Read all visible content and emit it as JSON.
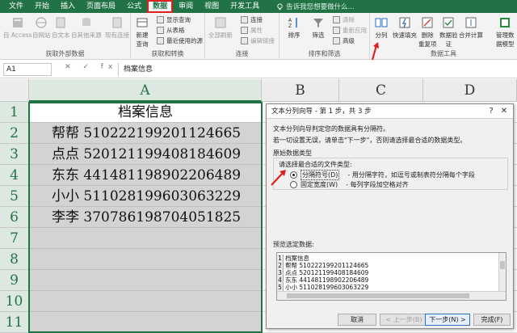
{
  "ribbon_tabs": [
    "文件",
    "开始",
    "插入",
    "页面布局",
    "公式",
    "数据",
    "审阅",
    "视图",
    "开发工具"
  ],
  "active_tab": "数据",
  "tell_me": "告诉我您想要做什么...",
  "ribbon": {
    "get_external": {
      "buttons": [
        "自 Access",
        "自网站",
        "自文本",
        "自其他来源",
        "现有连接"
      ],
      "label": "获取外部数据"
    },
    "get_transform": {
      "new_query": "新建\n查询",
      "show_queries": "显示查询",
      "from_table": "从表格",
      "recent_sources": "最近使用的源",
      "label": "获取和转换"
    },
    "connections": {
      "refresh_all": "全部刷新",
      "connections": "连接",
      "properties": "属性",
      "edit_links": "编辑链接",
      "label": "连接"
    },
    "sort_filter": {
      "sort": "排序",
      "filter": "筛选",
      "clear": "清除",
      "reapply": "重新应用",
      "advanced": "高级",
      "label": "排序和筛选"
    },
    "data_tools": {
      "text_to_columns": "分列",
      "flash_fill": "快速填充",
      "remove_duplicates": "删除\n重复项",
      "data_validation": "数据验\n证",
      "consolidate": "合并计算",
      "manage_model": "管理数\n据模型",
      "label": "数据工具"
    }
  },
  "formula_bar": {
    "name_box": "A1",
    "fx_symbols": "✕ ✓ fx",
    "content": "档案信息"
  },
  "sheet": {
    "columns": [
      "A",
      "B",
      "C",
      "D"
    ],
    "rows": [
      "1",
      "2",
      "3",
      "4",
      "5",
      "6",
      "7",
      "8",
      "9",
      "10",
      "11"
    ],
    "cells_A": [
      "档案信息",
      "帮帮  510222199201124665",
      "点点  520121199408184609",
      "东东  441481198902206489",
      "小小  511028199603063229",
      "李李  370786198704051825"
    ]
  },
  "dialog": {
    "title": "文本分列向导 - 第 1 步，共 3 步",
    "help": "?",
    "close": "✕",
    "intro": "文本分列向导判定您的数据具有分隔符。",
    "hint": "若一切设置无误，请单击\"下一步\"，否则请选择最合适的数据类型。",
    "group_label": "原始数据类型",
    "choose_label": "请选择最合适的文件类型:",
    "radio_delimited": "分隔符号(D)",
    "radio_delimited_desc": "- 用分隔字符，如逗号或制表符分隔每个字段",
    "radio_fixed": "固定宽度(W)",
    "radio_fixed_desc": "- 每列字段加空格对齐",
    "preview_label": "预览选定数据:",
    "preview_rows": [
      {
        "n": "1",
        "t": "档案信息"
      },
      {
        "n": "2",
        "t": "帮帮  510222199201124665"
      },
      {
        "n": "3",
        "t": "点点  520121199408184609"
      },
      {
        "n": "4",
        "t": "东东  441481198902206489"
      },
      {
        "n": "5",
        "t": "小小  511028199603063229"
      }
    ],
    "buttons": {
      "cancel": "取消",
      "back": "< 上一步(B)",
      "next": "下一步(N) >",
      "finish": "完成(F)"
    }
  },
  "colors": {
    "excel_green": "#217346",
    "highlight_red": "#e02020",
    "selection_gray": "#d3d3d3"
  }
}
